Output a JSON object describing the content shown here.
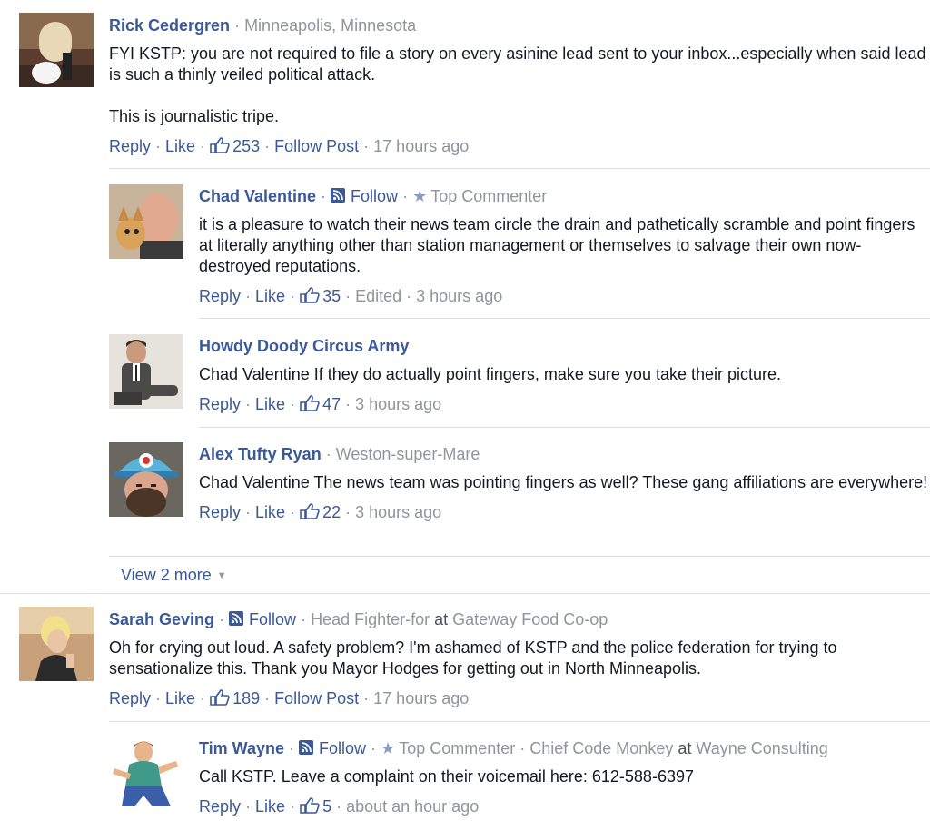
{
  "sep": "·",
  "actions": {
    "reply": "Reply",
    "like": "Like",
    "follow_post": "Follow Post",
    "follow": "Follow",
    "edited": "Edited",
    "top_commenter": "Top Commenter",
    "at": "at"
  },
  "comments": [
    {
      "author": "Rick Cedergren",
      "location": "Minneapolis, Minnesota",
      "paragraphs": [
        "FYI KSTP: you are not required to file a story on every asinine lead sent to your inbox...especially when said lead is such a thinly veiled political attack.",
        "This is journalistic tripe."
      ],
      "likes": "253",
      "time": "17 hours ago"
    },
    {
      "author": "Chad Valentine",
      "paragraphs": [
        "it is a pleasure to watch their news team circle the drain and pathetically scramble and point fingers at literally anything other than station management or themselves to salvage their own now-destroyed reputations."
      ],
      "likes": "35",
      "time": "3 hours ago"
    },
    {
      "author": "Howdy Doody Circus Army",
      "paragraphs": [
        "Chad Valentine If they do actually point fingers, make sure you take their picture."
      ],
      "likes": "47",
      "time": "3 hours ago"
    },
    {
      "author": "Alex Tufty Ryan",
      "location": "Weston-super-Mare",
      "paragraphs": [
        "Chad Valentine The news team was pointing fingers as well? These gang affiliations are everywhere!"
      ],
      "likes": "22",
      "time": "3 hours ago"
    },
    {
      "author": "Sarah Geving",
      "job": "Head Fighter-for",
      "employer": "Gateway Food Co-op",
      "paragraphs": [
        "Oh for crying out loud. A safety problem? I'm ashamed of KSTP and the police federation for trying to sensationalize this. Thank you Mayor Hodges for getting out in North Minneapolis."
      ],
      "likes": "189",
      "time": "17 hours ago"
    },
    {
      "author": "Tim Wayne",
      "job": "Chief Code Monkey",
      "employer": "Wayne Consulting",
      "paragraphs": [
        "Call KSTP. Leave a complaint on their voicemail here: 612-588-6397"
      ],
      "likes": "5",
      "time": "about an hour ago"
    }
  ],
  "view_more": "View 2 more",
  "colors": {
    "link": "#3b5998",
    "meta": "#90949c",
    "text": "#141823",
    "divider": "#dcdee3"
  }
}
